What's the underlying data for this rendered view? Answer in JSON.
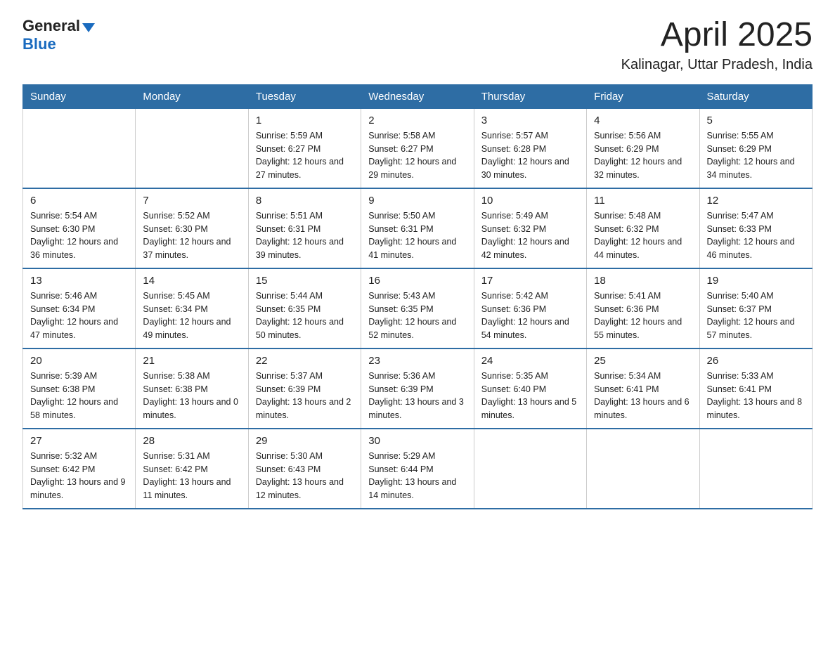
{
  "header": {
    "logo_general": "General",
    "logo_blue": "Blue",
    "month_title": "April 2025",
    "location": "Kalinagar, Uttar Pradesh, India"
  },
  "days_of_week": [
    "Sunday",
    "Monday",
    "Tuesday",
    "Wednesday",
    "Thursday",
    "Friday",
    "Saturday"
  ],
  "weeks": [
    [
      {
        "day": "",
        "info": ""
      },
      {
        "day": "",
        "info": ""
      },
      {
        "day": "1",
        "info": "Sunrise: 5:59 AM\nSunset: 6:27 PM\nDaylight: 12 hours\nand 27 minutes."
      },
      {
        "day": "2",
        "info": "Sunrise: 5:58 AM\nSunset: 6:27 PM\nDaylight: 12 hours\nand 29 minutes."
      },
      {
        "day": "3",
        "info": "Sunrise: 5:57 AM\nSunset: 6:28 PM\nDaylight: 12 hours\nand 30 minutes."
      },
      {
        "day": "4",
        "info": "Sunrise: 5:56 AM\nSunset: 6:29 PM\nDaylight: 12 hours\nand 32 minutes."
      },
      {
        "day": "5",
        "info": "Sunrise: 5:55 AM\nSunset: 6:29 PM\nDaylight: 12 hours\nand 34 minutes."
      }
    ],
    [
      {
        "day": "6",
        "info": "Sunrise: 5:54 AM\nSunset: 6:30 PM\nDaylight: 12 hours\nand 36 minutes."
      },
      {
        "day": "7",
        "info": "Sunrise: 5:52 AM\nSunset: 6:30 PM\nDaylight: 12 hours\nand 37 minutes."
      },
      {
        "day": "8",
        "info": "Sunrise: 5:51 AM\nSunset: 6:31 PM\nDaylight: 12 hours\nand 39 minutes."
      },
      {
        "day": "9",
        "info": "Sunrise: 5:50 AM\nSunset: 6:31 PM\nDaylight: 12 hours\nand 41 minutes."
      },
      {
        "day": "10",
        "info": "Sunrise: 5:49 AM\nSunset: 6:32 PM\nDaylight: 12 hours\nand 42 minutes."
      },
      {
        "day": "11",
        "info": "Sunrise: 5:48 AM\nSunset: 6:32 PM\nDaylight: 12 hours\nand 44 minutes."
      },
      {
        "day": "12",
        "info": "Sunrise: 5:47 AM\nSunset: 6:33 PM\nDaylight: 12 hours\nand 46 minutes."
      }
    ],
    [
      {
        "day": "13",
        "info": "Sunrise: 5:46 AM\nSunset: 6:34 PM\nDaylight: 12 hours\nand 47 minutes."
      },
      {
        "day": "14",
        "info": "Sunrise: 5:45 AM\nSunset: 6:34 PM\nDaylight: 12 hours\nand 49 minutes."
      },
      {
        "day": "15",
        "info": "Sunrise: 5:44 AM\nSunset: 6:35 PM\nDaylight: 12 hours\nand 50 minutes."
      },
      {
        "day": "16",
        "info": "Sunrise: 5:43 AM\nSunset: 6:35 PM\nDaylight: 12 hours\nand 52 minutes."
      },
      {
        "day": "17",
        "info": "Sunrise: 5:42 AM\nSunset: 6:36 PM\nDaylight: 12 hours\nand 54 minutes."
      },
      {
        "day": "18",
        "info": "Sunrise: 5:41 AM\nSunset: 6:36 PM\nDaylight: 12 hours\nand 55 minutes."
      },
      {
        "day": "19",
        "info": "Sunrise: 5:40 AM\nSunset: 6:37 PM\nDaylight: 12 hours\nand 57 minutes."
      }
    ],
    [
      {
        "day": "20",
        "info": "Sunrise: 5:39 AM\nSunset: 6:38 PM\nDaylight: 12 hours\nand 58 minutes."
      },
      {
        "day": "21",
        "info": "Sunrise: 5:38 AM\nSunset: 6:38 PM\nDaylight: 13 hours\nand 0 minutes."
      },
      {
        "day": "22",
        "info": "Sunrise: 5:37 AM\nSunset: 6:39 PM\nDaylight: 13 hours\nand 2 minutes."
      },
      {
        "day": "23",
        "info": "Sunrise: 5:36 AM\nSunset: 6:39 PM\nDaylight: 13 hours\nand 3 minutes."
      },
      {
        "day": "24",
        "info": "Sunrise: 5:35 AM\nSunset: 6:40 PM\nDaylight: 13 hours\nand 5 minutes."
      },
      {
        "day": "25",
        "info": "Sunrise: 5:34 AM\nSunset: 6:41 PM\nDaylight: 13 hours\nand 6 minutes."
      },
      {
        "day": "26",
        "info": "Sunrise: 5:33 AM\nSunset: 6:41 PM\nDaylight: 13 hours\nand 8 minutes."
      }
    ],
    [
      {
        "day": "27",
        "info": "Sunrise: 5:32 AM\nSunset: 6:42 PM\nDaylight: 13 hours\nand 9 minutes."
      },
      {
        "day": "28",
        "info": "Sunrise: 5:31 AM\nSunset: 6:42 PM\nDaylight: 13 hours\nand 11 minutes."
      },
      {
        "day": "29",
        "info": "Sunrise: 5:30 AM\nSunset: 6:43 PM\nDaylight: 13 hours\nand 12 minutes."
      },
      {
        "day": "30",
        "info": "Sunrise: 5:29 AM\nSunset: 6:44 PM\nDaylight: 13 hours\nand 14 minutes."
      },
      {
        "day": "",
        "info": ""
      },
      {
        "day": "",
        "info": ""
      },
      {
        "day": "",
        "info": ""
      }
    ]
  ]
}
